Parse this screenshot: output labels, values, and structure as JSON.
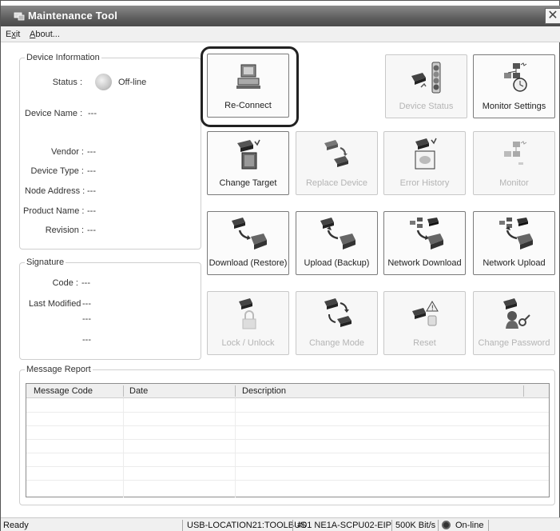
{
  "window": {
    "title": "Maintenance Tool",
    "close_glyph": "✕"
  },
  "menu": {
    "exit": "Exit",
    "about": "About..."
  },
  "device_info": {
    "legend": "Device Information",
    "status_label": "Status :",
    "status_value": "Off-line",
    "device_name_label": "Device Name :",
    "device_name_value": "---",
    "vendor_label": "Vendor :",
    "vendor_value": "---",
    "device_type_label": "Device Type :",
    "device_type_value": "---",
    "node_address_label": "Node Address :",
    "node_address_value": "---",
    "product_name_label": "Product Name :",
    "product_name_value": "---",
    "revision_label": "Revision :",
    "revision_value": "---"
  },
  "signature": {
    "legend": "Signature",
    "code_label": "Code :",
    "code_value": "---",
    "last_modified_label": "Last Modified",
    "last_modified_value": "---",
    "last_modified_line2": "---",
    "last_modified_line3": "---"
  },
  "buttons": {
    "reconnect": "Re-Connect",
    "device_status": "Device Status",
    "monitor_settings": "Monitor Settings",
    "change_target": "Change Target",
    "replace_device": "Replace Device",
    "error_history": "Error History",
    "monitor": "Monitor",
    "download_restore": "Download (Restore)",
    "upload_backup": "Upload (Backup)",
    "network_download": "Network Download",
    "network_upload": "Network Upload",
    "lock_unlock": "Lock / Unlock",
    "change_mode": "Change Mode",
    "reset": "Reset",
    "change_password": "Change Password"
  },
  "message_report": {
    "legend": "Message Report",
    "columns": [
      "Message Code",
      "Date",
      "Description"
    ]
  },
  "statusbar": {
    "state": "Ready",
    "port": "USB-LOCATION21:TOOLBUS",
    "device": "#01 NE1A-SCPU02-EIP",
    "baud": "500K Bit/s",
    "connection": "On-line"
  },
  "colors": {
    "titlebar": "#5e5e5e",
    "disabled_text": "#b4b4b4",
    "highlight_ring": "#222222"
  },
  "icons": [
    "app-icon",
    "close-icon",
    "status-indicator-icon",
    "computer-icon",
    "traffic-light-icon",
    "network-clock-icon",
    "device-chip-icon",
    "device-swap-icon",
    "error-log-icon",
    "network-monitor-icon",
    "download-icon",
    "upload-icon",
    "network-download-icon",
    "network-upload-icon",
    "lock-icon",
    "change-mode-icon",
    "reset-warning-icon",
    "password-key-icon",
    "online-indicator-icon"
  ]
}
